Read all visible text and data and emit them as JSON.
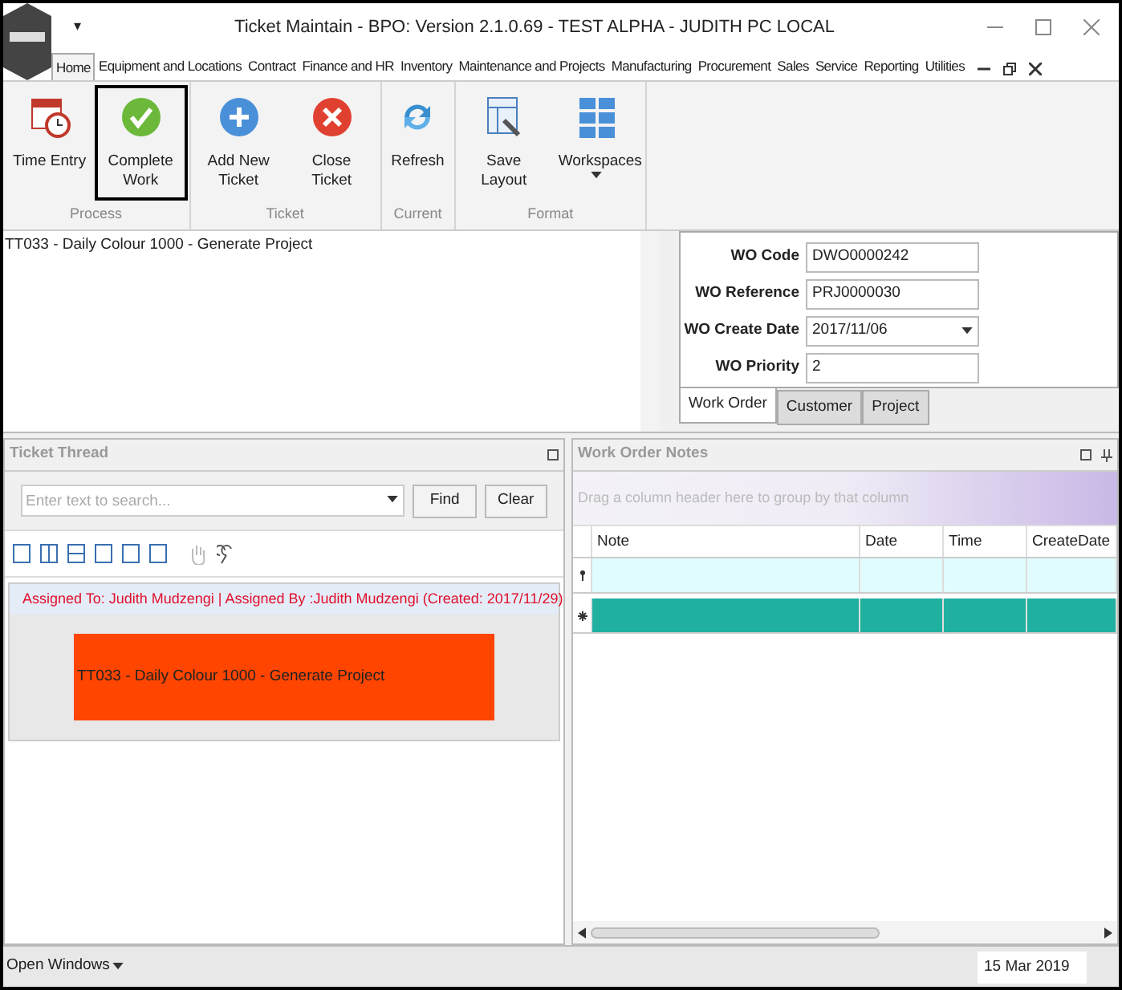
{
  "window": {
    "title": "Ticket Maintain - BPO: Version 2.1.0.69 - TEST ALPHA - JUDITH PC LOCAL",
    "quick_access": "▾"
  },
  "menu_tabs": [
    {
      "label": "Home",
      "selected": true
    },
    {
      "label": "Equipment and Locations",
      "selected": false
    },
    {
      "label": "Contract",
      "selected": false
    },
    {
      "label": "Finance and HR",
      "selected": false
    },
    {
      "label": "Inventory",
      "selected": false
    },
    {
      "label": "Maintenance and Projects",
      "selected": false
    },
    {
      "label": "Manufacturing",
      "selected": false
    },
    {
      "label": "Procurement",
      "selected": false
    },
    {
      "label": "Sales",
      "selected": false
    },
    {
      "label": "Service",
      "selected": false
    },
    {
      "label": "Reporting",
      "selected": false
    },
    {
      "label": "Utilities",
      "selected": false
    }
  ],
  "ribbon_groups": [
    {
      "label": "Process",
      "buttons": [
        {
          "label": "Time Entry",
          "kind": "calendar",
          "focused": false
        },
        {
          "label": "Complete Work",
          "kind": "check",
          "focused": true
        }
      ]
    },
    {
      "label": "Ticket",
      "buttons": [
        {
          "label": "Add New Ticket",
          "kind": "add",
          "focused": false
        },
        {
          "label": "Close Ticket",
          "kind": "close",
          "focused": false
        }
      ]
    },
    {
      "label": "Current",
      "buttons": [
        {
          "label": "Refresh",
          "kind": "refresh",
          "focused": false
        }
      ]
    },
    {
      "label": "Format",
      "buttons": [
        {
          "label": "Save Layout",
          "kind": "layout",
          "focused": false
        },
        {
          "label": "Workspaces",
          "kind": "grid",
          "focused": false
        }
      ]
    }
  ],
  "description": "TT033 - Daily Colour 1000 - Generate Project",
  "wo_fields": [
    {
      "label": "WO Code",
      "value": "DWO0000242",
      "kind": "text"
    },
    {
      "label": "WO Reference",
      "value": "PRJ0000030",
      "kind": "text"
    },
    {
      "label": "WO Create Date",
      "value": "2017/11/06",
      "kind": "dropdown"
    },
    {
      "label": "WO Priority",
      "value": "2",
      "kind": "text"
    }
  ],
  "wo_tabs": [
    {
      "label": "Work Order",
      "selected": true
    },
    {
      "label": "Customer",
      "selected": false
    },
    {
      "label": "Project",
      "selected": false
    }
  ],
  "ticket_thread": {
    "title": "Ticket Thread",
    "search_placeholder": "Enter text to search...",
    "buttons": [
      "Find",
      "Clear"
    ],
    "entry": {
      "header": "Assigned To: Judith Mudzengi | Assigned By :Judith Mudzengi (Created: 2017/11/29)",
      "body": "TT033 - Daily Colour 1000 - Generate Project",
      "color": "#ff4500"
    }
  },
  "work_order_notes": {
    "title": "Work Order Notes",
    "group_hint": "Drag a column header here to group by that column",
    "columns": [
      "Note",
      "Date",
      "Time",
      "CreateDate"
    ],
    "rows": [
      {
        "kind": "filter",
        "selected": false
      },
      {
        "kind": "new",
        "selected": true
      }
    ]
  },
  "status_bar": {
    "open_windows": "Open Windows",
    "date": "15 Mar 2019"
  }
}
